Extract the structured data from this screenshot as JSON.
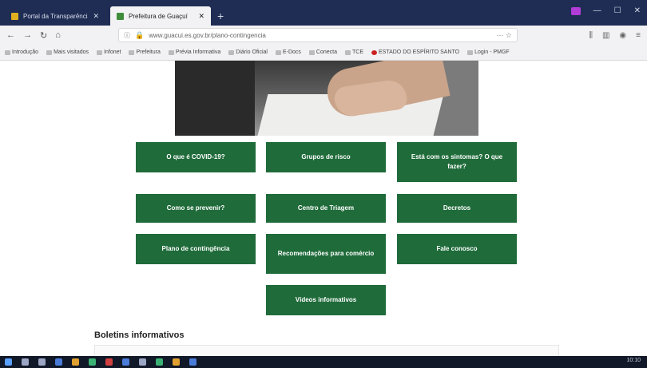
{
  "browser": {
    "tabs": [
      {
        "title": "Portal da Transparência",
        "active": false
      },
      {
        "title": "Prefeitura de Guaçuí",
        "active": true
      }
    ],
    "new_tab_symbol": "+",
    "url": "www.guacui.es.gov.br/plano-contingencia",
    "bookmarks": [
      "Introdução",
      "Mais visitados",
      "Infonet",
      "Prefeitura",
      "Prévia Informativa",
      "Diário Oficial",
      "E-Docs",
      "Conecta",
      "TCE",
      "ESTADO DO ESPÍRITO SANTO",
      "Login - PMGF"
    ]
  },
  "page": {
    "buttons_row1": [
      "O que é COVID-19?",
      "Grupos de risco",
      "Está com os sintomas? O que fazer?"
    ],
    "buttons_row2": [
      "Como se prevenir?",
      "Centro de Triagem",
      "Decretos"
    ],
    "buttons_row3": [
      "Plano de contingência",
      "Recomendações para comércio",
      "Fale conosco"
    ],
    "buttons_row4": [
      "Vídeos informativos"
    ],
    "section_title": "Boletins informativos"
  },
  "taskbar": {
    "clock": "10:10"
  },
  "colors": {
    "accent": "#1f6b3a",
    "tabbar": "#1f2d54"
  }
}
